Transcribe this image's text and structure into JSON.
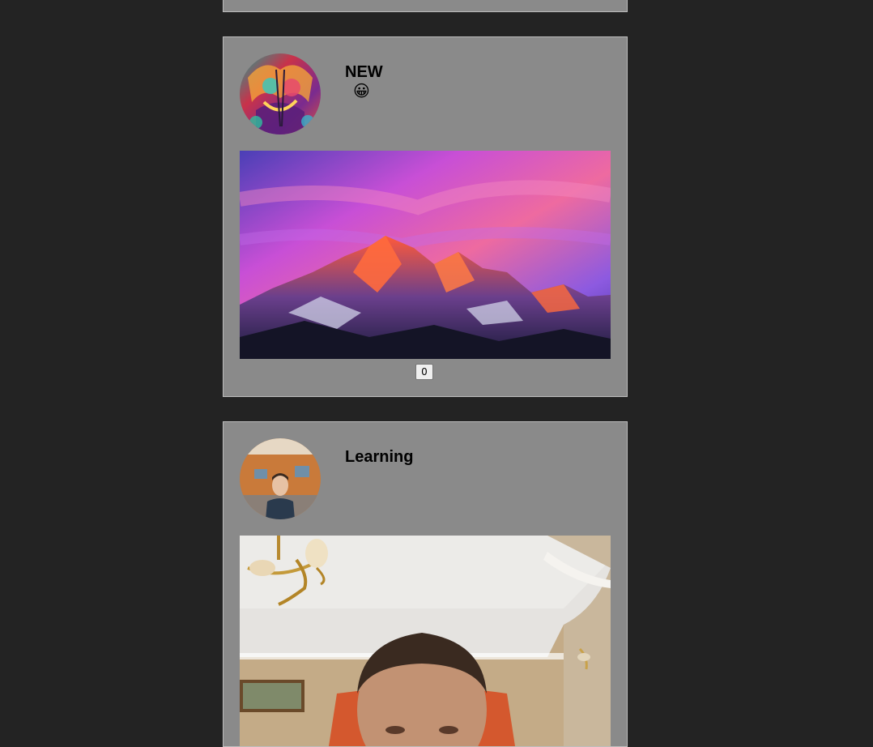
{
  "posts": [
    {
      "title": "NEW",
      "emoji": "😀",
      "like_count": "0",
      "avatar_icon": "colorful-warrior-art-avatar",
      "image": "mountain-sunset-photo"
    },
    {
      "title": "Learning",
      "avatar_icon": "person-in-room-avatar",
      "image": "person-selfie-photo"
    }
  ],
  "colors": {
    "page_background": "#232323",
    "card_background": "#8a8a8a",
    "card_border": "#bdbdbd"
  }
}
